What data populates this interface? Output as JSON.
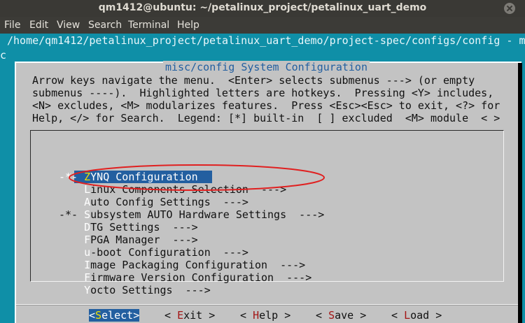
{
  "window": {
    "title": "qm1412@ubuntu: ~/petalinux_project/petalinux_uart_demo"
  },
  "menubar": {
    "items": [
      "File",
      "Edit",
      "View",
      "Search",
      "Terminal",
      "Help"
    ]
  },
  "terminal": {
    "path_line": "/home/qm1412/petalinux_project/petalinux_uart_demo/project-spec/configs/config - m",
    "second_line": "c"
  },
  "dialog": {
    "title": "misc/config System Configuration",
    "help_lines": [
      "Arrow keys navigate the menu.  <Enter> selects submenus ---> (or empty",
      "submenus ----).  Highlighted letters are hotkeys.  Pressing <Y> includes,",
      "<N> excludes, <M> modularizes features.  Press <Esc><Esc> to exit, <?> for",
      "Help, </> for Search.  Legend: [*] built-in  [ ] excluded  <M> module  < >"
    ],
    "menu_items": [
      {
        "prefix": "-*- ",
        "hotkey": "Z",
        "rest": "YNQ Configuration",
        "selected": true
      },
      {
        "prefix": "    ",
        "hotkey": "L",
        "rest": "inux Components Selection  --->"
      },
      {
        "prefix": "    ",
        "hotkey": "A",
        "rest": "uto Config Settings  --->"
      },
      {
        "prefix": "-*- ",
        "hotkey": "S",
        "rest": "ubsystem AUTO Hardware Settings  --->"
      },
      {
        "prefix": "    ",
        "hotkey": "D",
        "rest": "TG Settings  --->"
      },
      {
        "prefix": "    ",
        "hotkey": "F",
        "rest": "PGA Manager  --->"
      },
      {
        "prefix": "    ",
        "hotkey": "u",
        "rest": "-boot Configuration  --->"
      },
      {
        "prefix": "    ",
        "hotkey": "I",
        "rest": "mage Packaging Configuration  --->"
      },
      {
        "prefix": "    ",
        "hotkey": "F",
        "rest": "irmware Version Configuration  --->"
      },
      {
        "prefix": "    ",
        "hotkey": "Y",
        "rest": "octo Settings  --->"
      }
    ],
    "buttons": [
      {
        "pre": "<",
        "hotkey": "S",
        "rest": "elect>",
        "active": true
      },
      {
        "pre": "< ",
        "hotkey": "E",
        "rest": "xit >"
      },
      {
        "pre": "< ",
        "hotkey": "H",
        "rest": "elp >"
      },
      {
        "pre": "< ",
        "hotkey": "S",
        "rest": "ave >"
      },
      {
        "pre": "< ",
        "hotkey": "L",
        "rest": "oad >"
      }
    ]
  },
  "colors": {
    "terminal_bg": "#0f8fa7",
    "dialog_bg": "#c3c3c3",
    "highlight": "#235fa0",
    "annotation": "#e02020"
  }
}
